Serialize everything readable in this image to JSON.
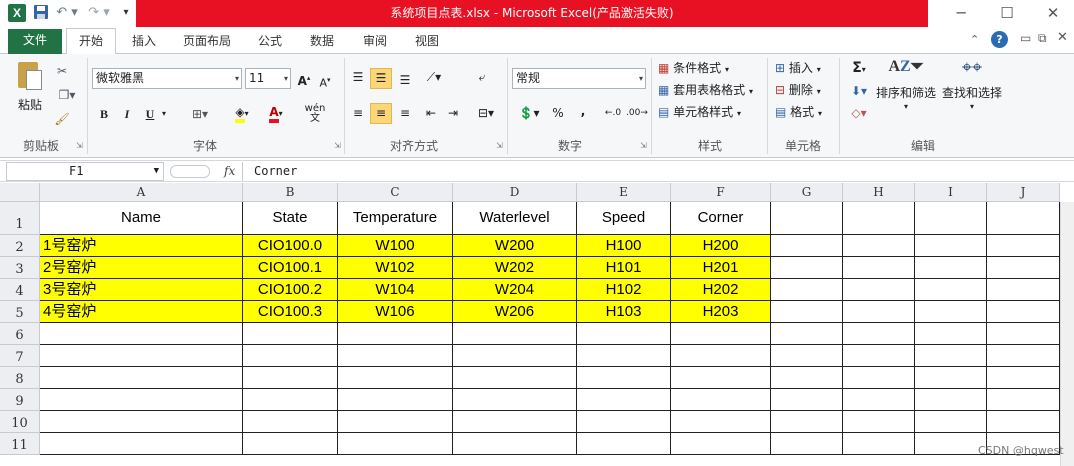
{
  "window": {
    "title": "系统项目点表.xlsx  -  Microsoft Excel(产品激活失败)",
    "controls": [
      "─",
      "☐",
      "✕"
    ]
  },
  "quick_access": {
    "app_icon": "excel-icon",
    "items": [
      "save-icon",
      "undo-icon",
      "redo-icon",
      "customize-icon"
    ]
  },
  "tabs": [
    "文件",
    "开始",
    "插入",
    "页面布局",
    "公式",
    "数据",
    "审阅",
    "视图"
  ],
  "active_tab": "开始",
  "ribbon": {
    "clipboard": {
      "label": "剪贴板",
      "paste": "粘贴"
    },
    "font": {
      "label": "字体",
      "name": "微软雅黑",
      "size": "11",
      "bold": "B",
      "italic": "I",
      "underline": "U",
      "phonetic": "wén 文"
    },
    "alignment": {
      "label": "对齐方式"
    },
    "number": {
      "label": "数字",
      "format": "常规",
      "percent": "%",
      "comma": ","
    },
    "styles": {
      "label": "样式",
      "conditional": "条件格式",
      "table": "套用表格格式",
      "cell": "单元格样式"
    },
    "cells": {
      "label": "单元格",
      "insert": "插入",
      "delete": "删除",
      "format": "格式"
    },
    "editing": {
      "label": "编辑",
      "sigma": "Σ",
      "sort": "排序和筛选",
      "find": "查找和选择"
    }
  },
  "formula_bar": {
    "name_box": "F1",
    "fx": "fx",
    "content": "Corner"
  },
  "sheet": {
    "columns": [
      "A",
      "B",
      "C",
      "D",
      "E",
      "F",
      "G",
      "H",
      "I",
      "J"
    ],
    "rows": [
      "1",
      "2",
      "3",
      "4",
      "5",
      "6",
      "7",
      "8",
      "9",
      "10",
      "11"
    ],
    "header": [
      "Name",
      "State",
      "Temperature",
      "Waterlevel",
      "Speed",
      "Corner"
    ],
    "data": [
      [
        "1号窑炉",
        "CIO100.0",
        "W100",
        "W200",
        "H100",
        "H200"
      ],
      [
        "2号窑炉",
        "CIO100.1",
        "W102",
        "W202",
        "H101",
        "H201"
      ],
      [
        "3号窑炉",
        "CIO100.2",
        "W104",
        "W204",
        "H102",
        "H202"
      ],
      [
        "4号窑炉",
        "CIO100.3",
        "W106",
        "W206",
        "H103",
        "H203"
      ]
    ],
    "highlight_color": "#ffff00"
  },
  "watermark": "CSDN @hqwest",
  "colors": {
    "title_bar": "#e81123",
    "file_tab": "#217346",
    "ribbon_bg": "#f6f7f9"
  }
}
